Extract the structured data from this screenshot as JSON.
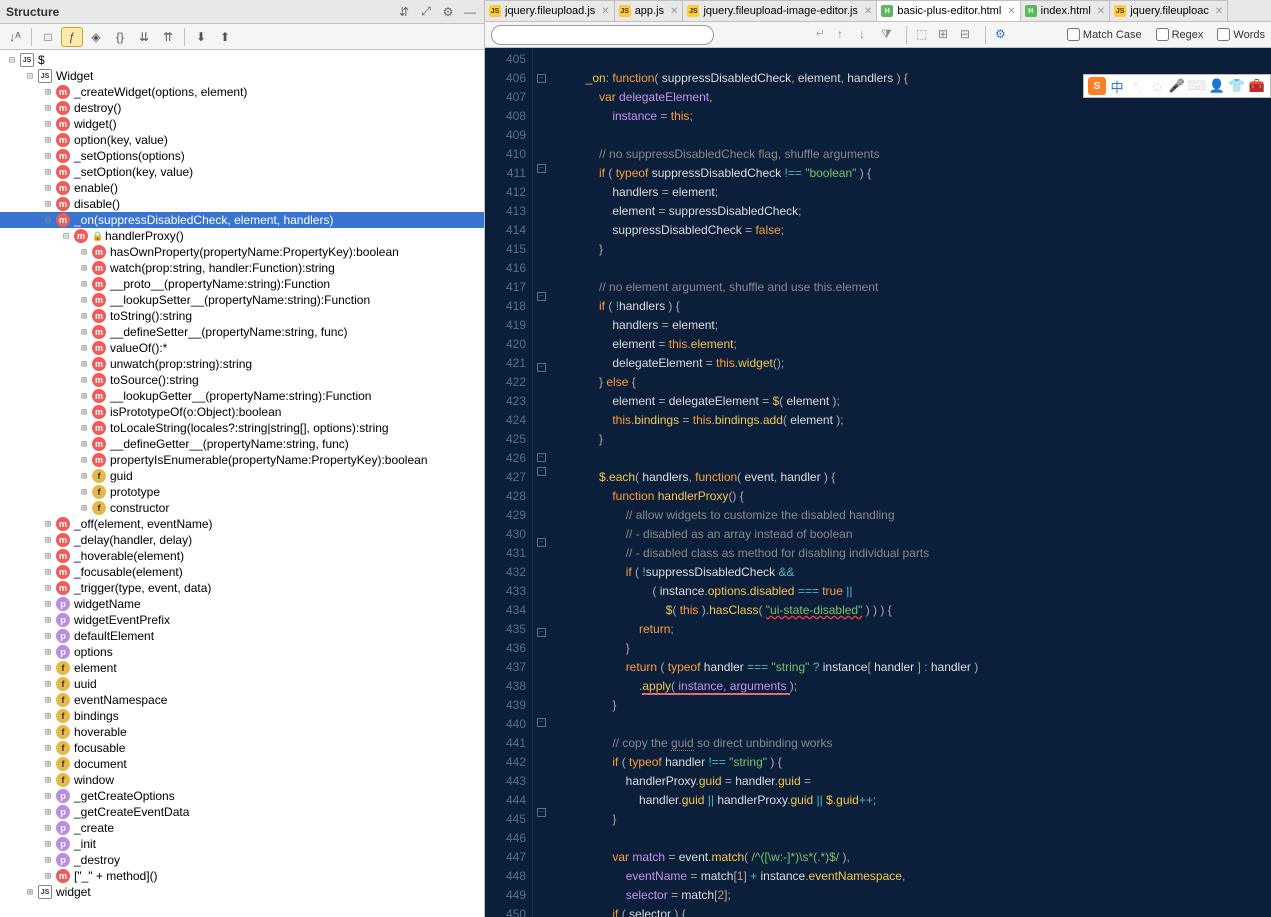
{
  "panel": {
    "title": "Structure"
  },
  "tree": [
    {
      "d": 0,
      "e": "-",
      "t": "js",
      "label": "$"
    },
    {
      "d": 1,
      "e": "-",
      "t": "js",
      "label": "Widget"
    },
    {
      "d": 2,
      "e": "+",
      "t": "m",
      "label": "_createWidget(options, element)"
    },
    {
      "d": 2,
      "e": "+",
      "t": "m",
      "label": "destroy()"
    },
    {
      "d": 2,
      "e": "+",
      "t": "m",
      "label": "widget()"
    },
    {
      "d": 2,
      "e": "+",
      "t": "m",
      "label": "option(key, value)"
    },
    {
      "d": 2,
      "e": "+",
      "t": "m",
      "label": "_setOptions(options)"
    },
    {
      "d": 2,
      "e": "+",
      "t": "m",
      "label": "_setOption(key, value)"
    },
    {
      "d": 2,
      "e": "+",
      "t": "m",
      "label": "enable()"
    },
    {
      "d": 2,
      "e": "+",
      "t": "m",
      "label": "disable()"
    },
    {
      "d": 2,
      "e": "-",
      "t": "m",
      "label": "_on(suppressDisabledCheck, element, handlers)",
      "sel": true
    },
    {
      "d": 3,
      "e": "-",
      "t": "m",
      "label": "handlerProxy()",
      "lock": true
    },
    {
      "d": 4,
      "e": "+",
      "t": "m",
      "label": "hasOwnProperty(propertyName:PropertyKey):boolean"
    },
    {
      "d": 4,
      "e": "+",
      "t": "m",
      "label": "watch(prop:string, handler:Function):string"
    },
    {
      "d": 4,
      "e": "+",
      "t": "m",
      "label": "__proto__(propertyName:string):Function"
    },
    {
      "d": 4,
      "e": "+",
      "t": "m",
      "label": "__lookupSetter__(propertyName:string):Function"
    },
    {
      "d": 4,
      "e": "+",
      "t": "m",
      "label": "toString():string"
    },
    {
      "d": 4,
      "e": "+",
      "t": "m",
      "label": "__defineSetter__(propertyName:string, func)"
    },
    {
      "d": 4,
      "e": "+",
      "t": "m",
      "label": "valueOf():*"
    },
    {
      "d": 4,
      "e": "+",
      "t": "m",
      "label": "unwatch(prop:string):string"
    },
    {
      "d": 4,
      "e": "+",
      "t": "m",
      "label": "toSource():string"
    },
    {
      "d": 4,
      "e": "+",
      "t": "m",
      "label": "__lookupGetter__(propertyName:string):Function"
    },
    {
      "d": 4,
      "e": "+",
      "t": "m",
      "label": "isPrototypeOf(o:Object):boolean"
    },
    {
      "d": 4,
      "e": "+",
      "t": "m",
      "label": "toLocaleString(locales?:string|string[], options):string"
    },
    {
      "d": 4,
      "e": "+",
      "t": "m",
      "label": "__defineGetter__(propertyName:string, func)"
    },
    {
      "d": 4,
      "e": "+",
      "t": "m",
      "label": "propertyIsEnumerable(propertyName:PropertyKey):boolean"
    },
    {
      "d": 4,
      "e": "+",
      "t": "f",
      "label": "guid"
    },
    {
      "d": 4,
      "e": "+",
      "t": "f",
      "label": "prototype"
    },
    {
      "d": 4,
      "e": "+",
      "t": "f",
      "label": "constructor"
    },
    {
      "d": 2,
      "e": "+",
      "t": "m",
      "label": "_off(element, eventName)"
    },
    {
      "d": 2,
      "e": "+",
      "t": "m",
      "label": "_delay(handler, delay)"
    },
    {
      "d": 2,
      "e": "+",
      "t": "m",
      "label": "_hoverable(element)"
    },
    {
      "d": 2,
      "e": "+",
      "t": "m",
      "label": "_focusable(element)"
    },
    {
      "d": 2,
      "e": "+",
      "t": "m",
      "label": "_trigger(type, event, data)"
    },
    {
      "d": 2,
      "e": "+",
      "t": "p",
      "label": "widgetName"
    },
    {
      "d": 2,
      "e": "+",
      "t": "p",
      "label": "widgetEventPrefix"
    },
    {
      "d": 2,
      "e": "+",
      "t": "p",
      "label": "defaultElement"
    },
    {
      "d": 2,
      "e": "+",
      "t": "p",
      "label": "options"
    },
    {
      "d": 2,
      "e": "+",
      "t": "f",
      "label": "element"
    },
    {
      "d": 2,
      "e": "+",
      "t": "f",
      "label": "uuid"
    },
    {
      "d": 2,
      "e": "+",
      "t": "f",
      "label": "eventNamespace"
    },
    {
      "d": 2,
      "e": "+",
      "t": "f",
      "label": "bindings"
    },
    {
      "d": 2,
      "e": "+",
      "t": "f",
      "label": "hoverable"
    },
    {
      "d": 2,
      "e": "+",
      "t": "f",
      "label": "focusable"
    },
    {
      "d": 2,
      "e": "+",
      "t": "f",
      "label": "document"
    },
    {
      "d": 2,
      "e": "+",
      "t": "f",
      "label": "window"
    },
    {
      "d": 2,
      "e": "+",
      "t": "p",
      "label": "_getCreateOptions"
    },
    {
      "d": 2,
      "e": "+",
      "t": "p",
      "label": "_getCreateEventData"
    },
    {
      "d": 2,
      "e": "+",
      "t": "p",
      "label": "_create"
    },
    {
      "d": 2,
      "e": "+",
      "t": "p",
      "label": "_init"
    },
    {
      "d": 2,
      "e": "+",
      "t": "p",
      "label": "_destroy"
    },
    {
      "d": 2,
      "e": "+",
      "t": "m",
      "label": "[\"_\" + method]()"
    },
    {
      "d": 1,
      "e": "+",
      "t": "js",
      "label": "widget"
    }
  ],
  "tabs": [
    {
      "t": "js",
      "label": "jquery.fileupload.js"
    },
    {
      "t": "js",
      "label": "app.js"
    },
    {
      "t": "js",
      "label": "jquery.fileupload-image-editor.js"
    },
    {
      "t": "html",
      "label": "basic-plus-editor.html",
      "active": true
    },
    {
      "t": "html",
      "label": "index.html"
    },
    {
      "t": "js",
      "label": "jquery.fileuploac"
    }
  ],
  "search": {
    "placeholder": "",
    "matchCase": "Match Case",
    "regex": "Regex",
    "words": "Words"
  },
  "ime": {
    "label": "中"
  },
  "lines": {
    "start": 405,
    "end": 450
  },
  "code": [
    "",
    "<span class='fn'>_on</span><span class='punct'>:</span> <span class='kw'>function</span><span class='punct'>(</span> suppressDisabledCheck<span class='punct'>,</span> element<span class='punct'>,</span> handlers <span class='punct'>) {</span>",
    "    <span class='kw'>var</span> <span class='var'>delegateElement</span><span class='punct'>,</span>",
    "        <span class='var'>instance</span> <span class='punct'>=</span> <span class='kw'>this</span><span class='punct'>;</span>",
    "",
    "    <span class='com'>// no suppressDisabledCheck flag, shuffle arguments</span>",
    "    <span class='kw'>if</span> <span class='punct'>(</span> <span class='kw'>typeof</span> suppressDisabledCheck <span class='op'>!==</span> <span class='str'>\"boolean\"</span> <span class='punct'>) {</span>",
    "        handlers <span class='punct'>=</span> element<span class='punct'>;</span>",
    "        element <span class='punct'>=</span> suppressDisabledCheck<span class='punct'>;</span>",
    "        suppressDisabledCheck <span class='punct'>=</span> <span class='kw'>false</span><span class='punct'>;</span>",
    "    <span class='punct'>}</span>",
    "",
    "    <span class='com'>// no element argument, shuffle and use this.element</span>",
    "    <span class='kw'>if</span> <span class='punct'>(</span> <span class='op'>!</span>handlers <span class='punct'>) {</span>",
    "        handlers <span class='punct'>=</span> element<span class='punct'>;</span>",
    "        element <span class='punct'>=</span> <span class='kw'>this</span><span class='punct'>.</span><span class='prop'>element</span><span class='punct'>;</span>",
    "        delegateElement <span class='punct'>=</span> <span class='kw'>this</span><span class='punct'>.</span><span class='fn'>widget</span><span class='punct'>();</span>",
    "    <span class='punct'>}</span> <span class='kw'>else</span> <span class='punct'>{</span>",
    "        element <span class='punct'>=</span> delegateElement <span class='punct'>=</span> <span class='fn'>$</span><span class='punct'>(</span> element <span class='punct'>);</span>",
    "        <span class='kw'>this</span><span class='punct'>.</span><span class='prop'>bindings</span> <span class='punct'>=</span> <span class='kw'>this</span><span class='punct'>.</span><span class='prop'>bindings</span><span class='punct'>.</span><span class='fn'>add</span><span class='punct'>(</span> element <span class='punct'>);</span>",
    "    <span class='punct'>}</span>",
    "",
    "    <span class='fn'>$</span><span class='punct'>.</span><span class='fn'>each</span><span class='punct'>(</span> handlers<span class='punct'>,</span> <span class='kw'>function</span><span class='punct'>(</span> event<span class='punct'>,</span> handler <span class='punct'>) {</span>",
    "        <span class='kw'>function</span> <span class='fn'>handlerProxy</span><span class='punct'>() {</span>",
    "            <span class='com'>// allow widgets to customize the disabled handling</span>",
    "            <span class='com'>// - disabled as an array instead of boolean</span>",
    "            <span class='com'>// - disabled class as method for disabling individual parts</span>",
    "            <span class='kw'>if</span> <span class='punct'>(</span> <span class='op'>!</span>suppressDisabledCheck <span class='op'>&&</span>",
    "                    <span class='punct'>(</span> instance<span class='punct'>.</span><span class='prop'>options</span><span class='punct'>.</span><span class='prop'>disabled</span> <span class='op'>===</span> <span class='kw'>true</span> <span class='op'>||</span>",
    "                        <span class='fn'>$</span><span class='punct'>(</span> <span class='kw'>this</span> <span class='punct'>).</span><span class='fn'>hasClass</span><span class='punct'>(</span> <span class='str err-underline'>\"ui-state-disabled\"</span> <span class='punct'>) ) ) {</span>",
    "                <span class='kw'>return</span><span class='punct'>;</span>",
    "            <span class='punct'>}</span>",
    "            <span class='kw'>return</span> <span class='punct'>(</span> <span class='kw'>typeof</span> handler <span class='op'>===</span> <span class='str'>\"string\"</span> <span class='op'>?</span> instance<span class='punct'>[</span> handler <span class='punct'>]</span> <span class='op'>:</span> handler <span class='punct'>)</span>",
    "                <span class='punct'>.</span><span class='fn red-underline'>apply</span><span class='punct red-underline'>( </span><span class='var red-underline'>instance</span><span class='punct red-underline'>, </span><span class='var red-underline'>arguments </span><span class='punct'>);</span>",
    "        <span class='punct'>}</span>",
    "",
    "        <span class='com'>// copy the <span style='border-bottom:1px dotted #8a8a8a'>guid</span> so direct unbinding works</span>",
    "        <span class='kw'>if</span> <span class='punct'>(</span> <span class='kw'>typeof</span> handler <span class='op'>!==</span> <span class='str'>\"string\"</span> <span class='punct'>) {</span>",
    "            handlerProxy<span class='punct'>.</span><span class='prop'>guid</span> <span class='punct'>=</span> handler<span class='punct'>.</span><span class='prop'>guid</span> <span class='punct'>=</span>",
    "                handler<span class='punct'>.</span><span class='prop'>guid</span> <span class='op'>||</span> handlerProxy<span class='punct'>.</span><span class='prop'>guid</span> <span class='op'>||</span> <span class='fn'>$</span><span class='punct'>.</span><span class='prop'>guid</span><span class='op'>++</span><span class='punct'>;</span>",
    "        <span class='punct'>}</span>",
    "",
    "        <span class='kw'>var</span> <span class='var'>match</span> <span class='punct'>=</span> event<span class='punct'>.</span><span class='fn'>match</span><span class='punct'>(</span> <span class='str'>/^([\\w:-]*)\\s*(.*)$/</span> <span class='punct'>),</span>",
    "            <span class='var'>eventName</span> <span class='punct'>=</span> match<span class='punct'>[</span><span class='num'>1</span><span class='punct'>]</span> <span class='op'>+</span> instance<span class='punct'>.</span><span class='prop'>eventNamespace</span><span class='punct'>,</span>",
    "            <span class='var'>selector</span> <span class='punct'>=</span> match<span class='punct'>[</span><span class='num'>2</span><span class='punct'>];</span>",
    "        <span class='kw'>if</span> <span class='punct'>(</span> selector <span class='punct'>) {</span>"
  ]
}
